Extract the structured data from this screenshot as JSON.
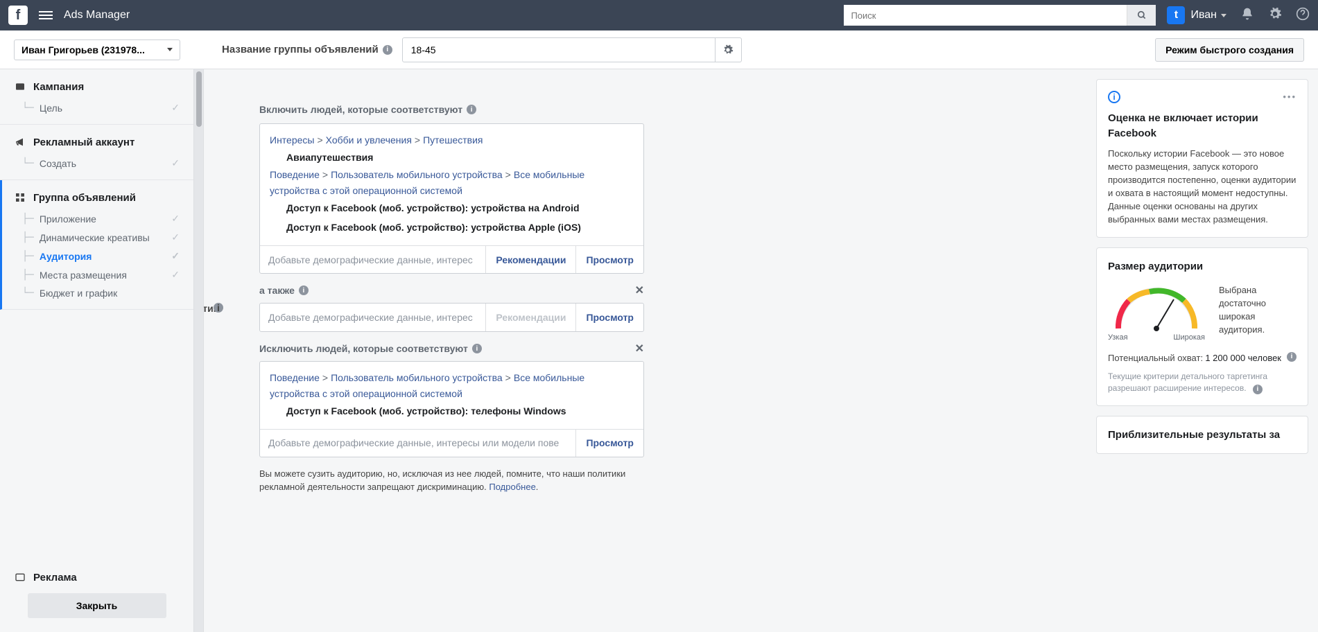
{
  "topbar": {
    "app": "Ads Manager",
    "search_ph": "Поиск",
    "user": "Иван"
  },
  "subbar": {
    "account": "Иван Григорьев (231978...",
    "label": "Название группы объявлений",
    "value": "18-45",
    "quick": "Режим быстрого создания"
  },
  "sidebar": {
    "campaign": {
      "head": "Кампания",
      "items": [
        {
          "label": "Цель",
          "done": true
        }
      ]
    },
    "adacc": {
      "head": "Рекламный аккаунт",
      "items": [
        {
          "label": "Создать",
          "done": true
        }
      ]
    },
    "adset": {
      "head": "Группа объявлений",
      "items": [
        {
          "label": "Приложение",
          "done": true
        },
        {
          "label": "Динамические креативы",
          "done": true
        },
        {
          "label": "Аудитория",
          "current": true,
          "done": true
        },
        {
          "label": "Места размещения",
          "done": true
        },
        {
          "label": "Бюджет и график"
        }
      ]
    },
    "ads": {
      "head": "Реклама"
    },
    "close": "Закрыть"
  },
  "main": {
    "include_title": "Включить людей, которые соответствуют",
    "crumb1": {
      "a": "Интересы",
      "b": "Хобби и увлечения",
      "c": "Путешествия"
    },
    "item1": "Авиапутешествия",
    "crumb2": {
      "a": "Поведение",
      "b": "Пользователь мобильного устройства",
      "c": "Все мобильные устройства с этой операционной системой"
    },
    "item2": "Доступ к Facebook (моб. устройство): устройства на Android",
    "item3": "Доступ к Facebook (моб. устройство): устройства Apple (iOS)",
    "ph_long": "Добавьте демографические данные, интерес",
    "ph_exclude": "Добавьте демографические данные, интересы или модели пове",
    "rec": "Рекомендации",
    "browse": "Просмотр",
    "and": "а также",
    "detailed": "Детальный таргетинг",
    "exclude_title": "Исключить людей, которые соответствуют",
    "item4": "Доступ к Facebook (моб. устройство): телефоны Windows",
    "narrow": "Вы можете сузить аудиторию, но, исключая из нее людей, помните, что наши политики рекламной деятельности запрещают дискриминацию.",
    "more": "Подробнее"
  },
  "right": {
    "c1_title": "Оценка не включает истории Facebook",
    "c1_body": "Поскольку истории Facebook — это новое место размещения, запуск которого производится постепенно, оценки аудитории и охвата в настоящий момент недоступны. Данные оценки основаны на других выбранных вами местах размещения.",
    "c2_title": "Размер аудитории",
    "c2_verdict": "Выбрана достаточно широкая аудитория.",
    "narrow": "Узкая",
    "wide": "Широкая",
    "reach_k": "Потенциальный охват:",
    "reach_v": "1 200 000 человек",
    "c2_note": "Текущие критерии детального таргетинга разрешают расширение интересов.",
    "c3_title": "Приблизительные результаты за"
  }
}
